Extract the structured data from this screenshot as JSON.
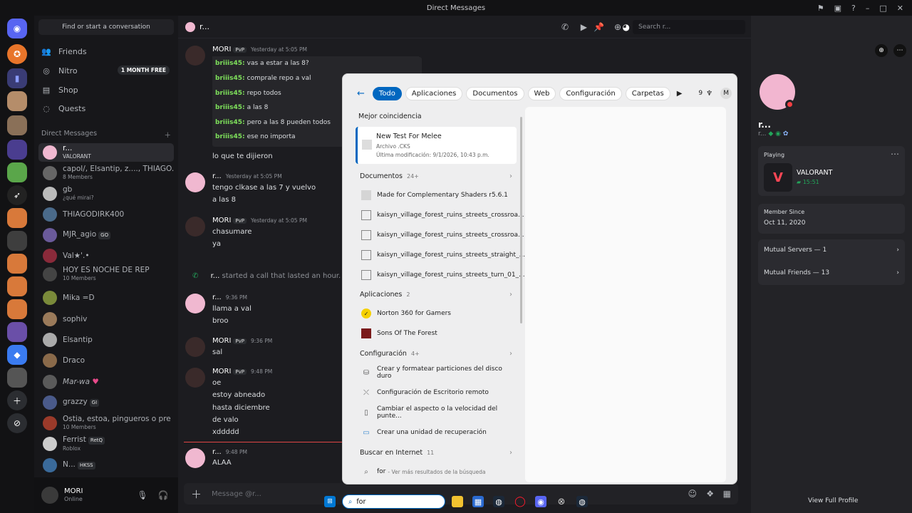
{
  "window": {
    "title": "Direct Messages"
  },
  "dm_panel": {
    "search_placeholder": "Find or start a conversation",
    "nav": [
      {
        "label": "Friends"
      },
      {
        "label": "Nitro",
        "badge": "1 MONTH FREE"
      },
      {
        "label": "Shop"
      },
      {
        "label": "Quests"
      }
    ],
    "section_title": "Direct Messages",
    "items": [
      {
        "name": "r...",
        "sub": "VALORANT"
      },
      {
        "name": "capol/, Elsantip, z...., THIAGO...",
        "sub": "8 Members"
      },
      {
        "name": "gb",
        "sub": "¿qué mirai?"
      },
      {
        "name": "THIAGODIRK400",
        "sub": ""
      },
      {
        "name": "MJR_agio",
        "tag": "GO",
        "sub": ""
      },
      {
        "name": "Val★'.•",
        "sub": ""
      },
      {
        "name": "HOY ES NOCHE DE REP",
        "sub": "10 Members"
      },
      {
        "name": "Mika =D",
        "sub": ""
      },
      {
        "name": "sophiv",
        "sub": ""
      },
      {
        "name": "Elsantip",
        "sub": ""
      },
      {
        "name": "Draco",
        "sub": ""
      },
      {
        "name": "Mar-wa",
        "sub": ""
      },
      {
        "name": "grazzy",
        "tag": "GI",
        "sub": ""
      },
      {
        "name": "Ostia, estoa, pingueros o pre ...",
        "sub": "10 Members"
      },
      {
        "name": "Ferrist",
        "tag": "RetQ",
        "sub": "Roblox"
      },
      {
        "name": "N...",
        "tag": "HKSS",
        "sub": ""
      }
    ]
  },
  "user": {
    "name": "MORI",
    "status": "Online"
  },
  "channel": {
    "name": "r...",
    "search_placeholder": "Search r...",
    "composer_placeholder": "Message @r..."
  },
  "messages": {
    "m1": {
      "author": "MORI",
      "tag": "PvP",
      "time": "Yesterday at 5:05 PM"
    },
    "quotes": [
      {
        "user": "briiis45:",
        "text": "vas a estar a las 8?"
      },
      {
        "user": "briiis45:",
        "text": "comprale repo a val"
      },
      {
        "user": "briiis45:",
        "text": "repo todos"
      },
      {
        "user": "briiis45:",
        "text": "a las 8"
      },
      {
        "user": "briiis45:",
        "text": "pero a las 8 pueden todos"
      },
      {
        "user": "briiis45:",
        "text": "ese no importa"
      }
    ],
    "m1_after": "lo que te dijieron",
    "m2": {
      "author": "r...",
      "time": "Yesterday at 5:05 PM",
      "lines": [
        "tengo clkase a las 7 y vuelvo",
        "a las 8"
      ]
    },
    "m3": {
      "author": "MORI",
      "tag": "PvP",
      "time": "Yesterday at 5:05 PM",
      "lines": [
        "chasumare",
        "ya"
      ]
    },
    "call": {
      "author": "r...",
      "text": "started a call that lasted an hour."
    },
    "m4": {
      "author": "r...",
      "time": "9:36 PM",
      "lines": [
        "llama a val",
        "broo"
      ]
    },
    "m5": {
      "author": "MORI",
      "tag": "PvP",
      "time": "9:36 PM",
      "lines": [
        "sal"
      ]
    },
    "m6": {
      "author": "MORI",
      "tag": "PvP",
      "time": "9:48 PM",
      "lines": [
        "oe",
        "estoy abneado",
        "hasta diciembre",
        "de valo",
        "xddddd"
      ]
    },
    "m7": {
      "author": "r...",
      "time": "9:48 PM",
      "lines": [
        "ALAA"
      ]
    }
  },
  "profile": {
    "name": "r...",
    "activity_label": "Playing",
    "game": "VALORANT",
    "game_time": "15:51",
    "member_since_label": "Member Since",
    "member_since": "Oct 11, 2020",
    "mutual_servers": "Mutual Servers — 1",
    "mutual_friends": "Mutual Friends — 13",
    "view_full": "View Full Profile"
  },
  "win_search": {
    "tabs": [
      "Todo",
      "Aplicaciones",
      "Documentos",
      "Web",
      "Configuración",
      "Carpetas"
    ],
    "extra": {
      "count": "9",
      "avatar": "M"
    },
    "best_match_label": "Mejor coincidencia",
    "best_match": {
      "title": "New Test For Melee",
      "type": "Archivo .CKS",
      "modified": "Última modificación: 9/1/2026, 10:43 p.m."
    },
    "docs_label": "Documentos",
    "docs_count": "24+",
    "docs": [
      "Made for Complementary Shaders r5.6.1",
      "kaisyn_village_forest_ruins_streets_crossroa...",
      "kaisyn_village_forest_ruins_streets_crossroa...",
      "kaisyn_village_forest_ruins_streets_straight_...",
      "kaisyn_village_forest_ruins_streets_turn_01_..."
    ],
    "apps_label": "Aplicaciones",
    "apps_count": "2",
    "apps": [
      "Norton 360 for Gamers",
      "Sons Of The Forest"
    ],
    "config_label": "Configuración",
    "config_count": "4+",
    "config": [
      "Crear y formatear particiones del disco duro",
      "Configuración de Escritorio remoto",
      "Cambiar el aspecto o la velocidad del punte...",
      "Crear una unidad de recuperación"
    ],
    "web_label": "Buscar en Internet",
    "web_count": "11",
    "web_query": "for",
    "web_hint": "- Ver más resultados de la búsqueda"
  },
  "taskbar": {
    "query": "for"
  },
  "colors": {
    "accent": "#0067c0",
    "discord": "#5865f2",
    "online": "#23a55a",
    "valorant": "#ff4655"
  }
}
